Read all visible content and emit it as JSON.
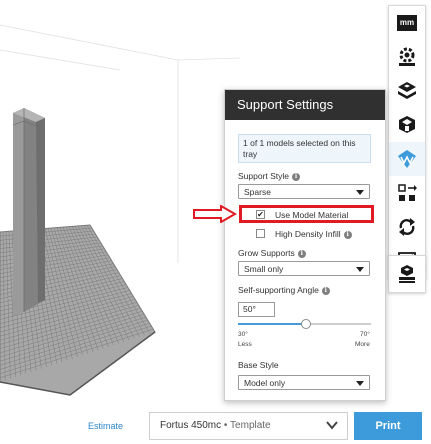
{
  "panel": {
    "title": "Support Settings",
    "info_text": "1 of 1 models selected on this tray",
    "support_style": {
      "label": "Support Style",
      "value": "Sparse"
    },
    "use_model_material": {
      "label": "Use Model Material",
      "checked": true
    },
    "high_density_infill": {
      "label": "High Density Infill",
      "checked": false
    },
    "grow_supports": {
      "label": "Grow Supports",
      "value": "Small only"
    },
    "self_supporting_angle": {
      "label": "Self-supporting Angle",
      "value": "50°",
      "slider_fraction": 0.5,
      "min_value": "30°",
      "min_label": "Less",
      "max_value": "70°",
      "max_label": "More"
    },
    "base_style": {
      "label": "Base Style",
      "value": "Model only"
    }
  },
  "bottom_bar": {
    "estimate_label": "Estimate",
    "printer_name": "Fortus 450mc",
    "printer_separator": "•",
    "printer_config": "Template",
    "print_label": "Print"
  },
  "toolbar": {
    "units_label": "mm",
    "icons": [
      "units-icon",
      "orient-icon",
      "layers-icon",
      "supports-icon",
      "material-icon",
      "arrange-icon",
      "rotate-icon",
      "scale-icon",
      "tray-icon"
    ]
  },
  "colors": {
    "accent": "#3d9bdb",
    "panel_header": "#303030",
    "highlight": "#e01b24",
    "model_gray": "#8f8f8f"
  }
}
